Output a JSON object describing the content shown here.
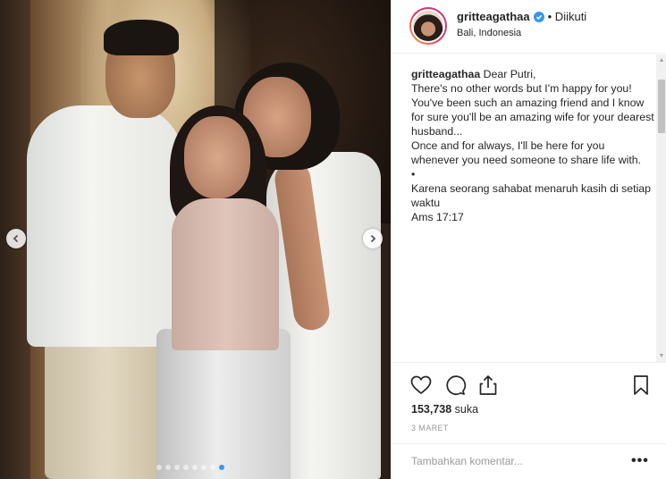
{
  "post": {
    "carousel": {
      "slide_count": 8,
      "active_slide": 8,
      "prev_icon": "chevron-left-icon",
      "next_icon": "chevron-right-icon"
    }
  },
  "header": {
    "username": "gritteagathaa",
    "verified": true,
    "follow_status": "• Diikuti",
    "location": "Bali, Indonesia"
  },
  "caption": {
    "username": "gritteagathaa",
    "lines": [
      "Dear Putri,",
      "There's no other words but I'm happy for you!",
      "You've been such an amazing friend and I know for sure you'll be an amazing wife for your dearest husband...",
      "Once and for always, I'll be here for you whenever you need someone to share life with.",
      "•",
      "Karena seorang sahabat menaruh kasih di setiap waktu",
      "Ams 17:17"
    ]
  },
  "actions": {
    "like_icon": "heart-icon",
    "comment_icon": "comment-icon",
    "share_icon": "share-icon",
    "save_icon": "bookmark-icon"
  },
  "likes": {
    "count": "153,738",
    "label": "suka"
  },
  "date": "3 MARET",
  "comment": {
    "placeholder": "Tambahkan komentar...",
    "more_label": "•••"
  },
  "colors": {
    "accent": "#3897f0",
    "border": "#efefef",
    "muted": "#999999"
  }
}
